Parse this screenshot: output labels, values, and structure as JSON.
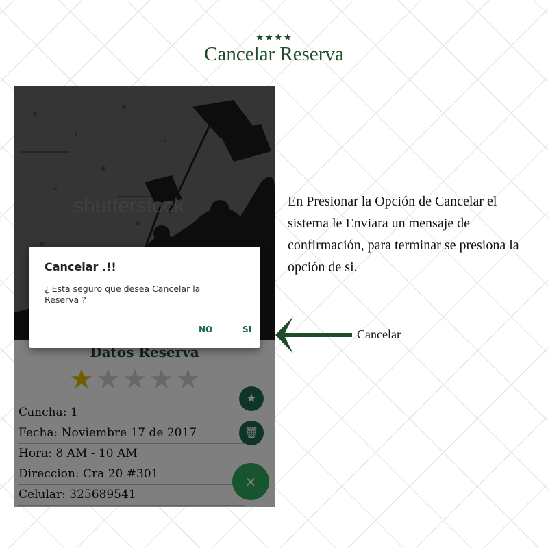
{
  "header": {
    "stars": "★★★★",
    "title": "Cancelar Reserva"
  },
  "phone": {
    "watermark": "shutterstock",
    "details_title": "Datos Reserva",
    "rating": {
      "value": 1,
      "max": 5
    },
    "rating_star_on": "★",
    "rating_stars_off": "★★★★",
    "info": [
      "Cancha: 1",
      "Fecha: Noviembre 17 de 2017",
      "Hora: 8 AM - 10 AM",
      "Direccion: Cra 20 #301",
      "Celular: 325689541"
    ],
    "fab_star_icon": "★",
    "fab_trash_icon": "🗑",
    "fab_close_label": "×",
    "dialog": {
      "title": "Cancelar .!!",
      "message": "¿ Esta seguro que desea Cancelar la Reserva ?",
      "no_label": "NO",
      "si_label": "SI"
    }
  },
  "annotation": {
    "description": "En Presionar la Opción de Cancelar el sistema le Enviara un mensaje de confirmación, para terminar se presiona la opción de si.",
    "arrow_label": "Cancelar"
  },
  "colors": {
    "brand_green": "#1f4d2c",
    "fab_green": "#2eaa5e",
    "star_gold": "#e5b800"
  }
}
